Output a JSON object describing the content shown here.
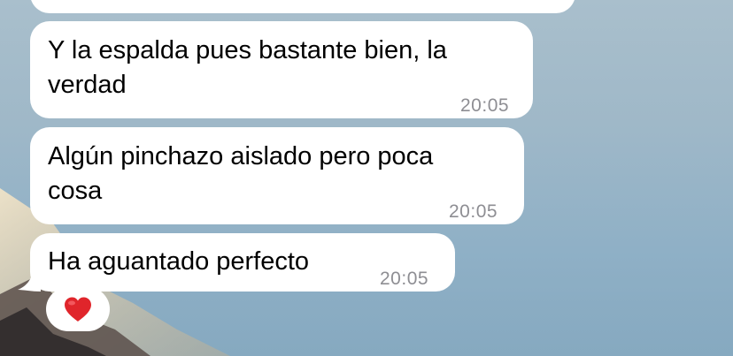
{
  "wallpaper": {
    "sky_color": "#9fb8c8",
    "mountain_icon": "mountain-wallpaper"
  },
  "messages": [
    {
      "text": "",
      "time": ""
    },
    {
      "text": "Y la espalda pues bastante bien, la\nverdad",
      "time": "20:05"
    },
    {
      "text": "Algún pinchazo aislado pero poca\ncosa",
      "time": "20:05"
    },
    {
      "text": "Ha aguantado perfecto",
      "time": "20:05"
    }
  ],
  "reaction": {
    "icon": "heart-icon",
    "color": "#e0252b"
  }
}
